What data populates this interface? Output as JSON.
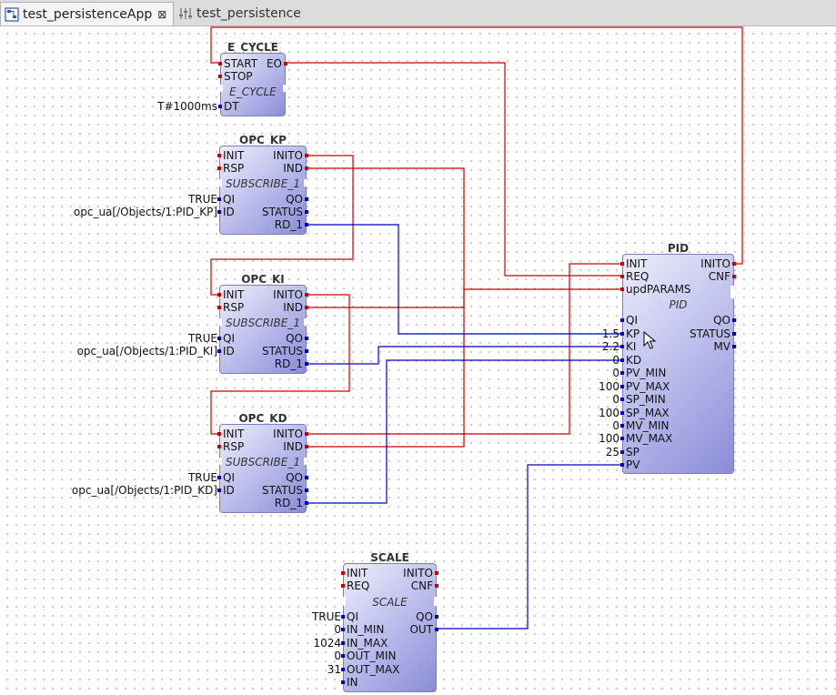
{
  "tabs": [
    {
      "label": "test_persistenceApp",
      "icon": "application-network-icon",
      "active": true
    },
    {
      "label": "test_persistence",
      "icon": "system-config-icon",
      "active": false
    }
  ],
  "colors": {
    "event": "#cc0000",
    "data": "#0000cc",
    "block_fill": "#b6b8ea",
    "block_border": "#7d7fb0"
  },
  "blocks": {
    "e_cycle": {
      "name": "E_CYCLE",
      "type": "E_CYCLE",
      "ports": {
        "start": "START",
        "stop": "STOP",
        "eo": "EO",
        "dt": "DT"
      },
      "constants": {
        "dt": "T#1000ms"
      }
    },
    "opc_kp": {
      "name": "OPC_KP",
      "type": "SUBSCRIBE_1",
      "ports": {
        "init": "INIT",
        "rsp": "RSP",
        "inito": "INITO",
        "ind": "IND",
        "qi": "QI",
        "id": "ID",
        "qo": "QO",
        "status": "STATUS",
        "rd_1": "RD_1"
      },
      "constants": {
        "qi": "TRUE",
        "id": "opc_ua[/Objects/1:PID_KP]"
      }
    },
    "opc_ki": {
      "name": "OPC_KI",
      "type": "SUBSCRIBE_1",
      "ports": {
        "init": "INIT",
        "rsp": "RSP",
        "inito": "INITO",
        "ind": "IND",
        "qi": "QI",
        "id": "ID",
        "qo": "QO",
        "status": "STATUS",
        "rd_1": "RD_1"
      },
      "constants": {
        "qi": "TRUE",
        "id": "opc_ua[/Objects/1:PID_KI]"
      }
    },
    "opc_kd": {
      "name": "OPC_KD",
      "type": "SUBSCRIBE_1",
      "ports": {
        "init": "INIT",
        "rsp": "RSP",
        "inito": "INITO",
        "ind": "IND",
        "qi": "QI",
        "id": "ID",
        "qo": "QO",
        "status": "STATUS",
        "rd_1": "RD_1"
      },
      "constants": {
        "qi": "TRUE",
        "id": "opc_ua[/Objects/1:PID_KD]"
      }
    },
    "pid": {
      "name": "PID",
      "type": "PID",
      "ports": {
        "init": "INIT",
        "req": "REQ",
        "upd": "updPARAMS",
        "inito": "INITO",
        "cnf": "CNF",
        "qi": "QI",
        "kp": "KP",
        "ki": "KI",
        "kd": "KD",
        "pv_min": "PV_MIN",
        "pv_max": "PV_MAX",
        "sp_min": "SP_MIN",
        "sp_max": "SP_MAX",
        "mv_min": "MV_MIN",
        "mv_max": "MV_MAX",
        "sp": "SP",
        "pv": "PV",
        "qo": "QO",
        "status": "STATUS",
        "mv": "MV"
      },
      "constants": {
        "kp": "1.5",
        "ki": "2.2",
        "kd": "0",
        "pv_min": "0",
        "pv_max": "100",
        "sp_min": "0",
        "sp_max": "100",
        "mv_min": "0",
        "mv_max": "100",
        "sp": "25"
      }
    },
    "scale": {
      "name": "SCALE",
      "type": "SCALE",
      "ports": {
        "init": "INIT",
        "req": "REQ",
        "inito": "INITO",
        "cnf": "CNF",
        "qi": "QI",
        "in_min": "IN_MIN",
        "in_max": "IN_MAX",
        "out_min": "OUT_MIN",
        "out_max": "OUT_MAX",
        "in": "IN",
        "qo": "QO",
        "out": "OUT"
      },
      "constants": {
        "qi": "TRUE",
        "in_min": "0",
        "in_max": "1024",
        "out_min": "0",
        "out_max": "31"
      }
    }
  }
}
